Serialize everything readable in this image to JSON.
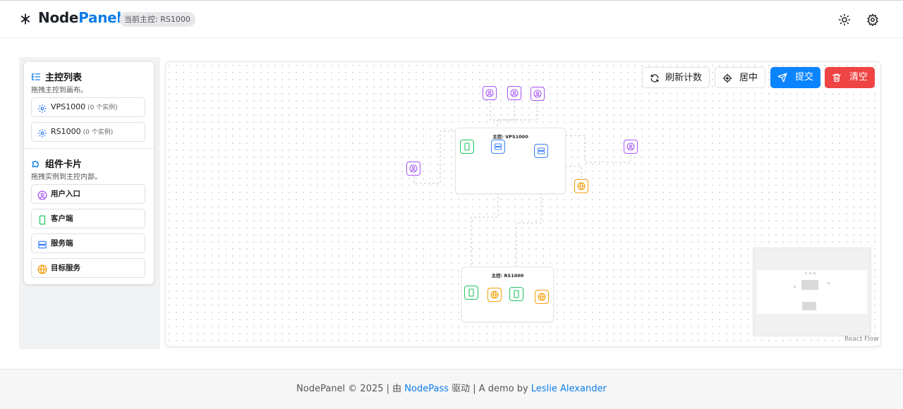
{
  "app": {
    "name_part1": "Node",
    "name_part2": "Panel",
    "current_master_badge": "当前主控: RS1000",
    "header_icons": [
      "sun-icon",
      "gear-icon"
    ]
  },
  "sidebar": {
    "masters_title": "主控列表",
    "masters_subtitle": "拖拽主控到画布。",
    "masters": [
      {
        "name": "VPS1000",
        "count": "(0 个实例)"
      },
      {
        "name": "RS1000",
        "count": "(0 个实例)"
      }
    ],
    "components_title": "组件卡片",
    "components_subtitle": "拖拽实例到主控内部。",
    "components": [
      {
        "label": "用户入口",
        "icon": "user-circle-icon",
        "color": "#a855f7"
      },
      {
        "label": "客户端",
        "icon": "smartphone-icon",
        "color": "#22c55e"
      },
      {
        "label": "服务端",
        "icon": "server-icon",
        "color": "#3b82f6"
      },
      {
        "label": "目标服务",
        "icon": "globe-icon",
        "color": "#f59e0b"
      }
    ]
  },
  "toolbar": {
    "refresh_label": "刷新计数",
    "center_label": "居中",
    "submit_label": "提交",
    "clear_label": "清空",
    "submit_color": "#0a84ff",
    "clear_color": "#ef4444"
  },
  "canvas": {
    "group_vps_title": "主控: VPS1000",
    "group_rs_title": "主控: RS1000",
    "attribution": "React Flow"
  },
  "footer": {
    "prefix": "NodePanel © 2025 | 由 ",
    "link1": "NodePass",
    "middle": " 驱动 | A demo by ",
    "link2": "Leslie Alexander"
  }
}
